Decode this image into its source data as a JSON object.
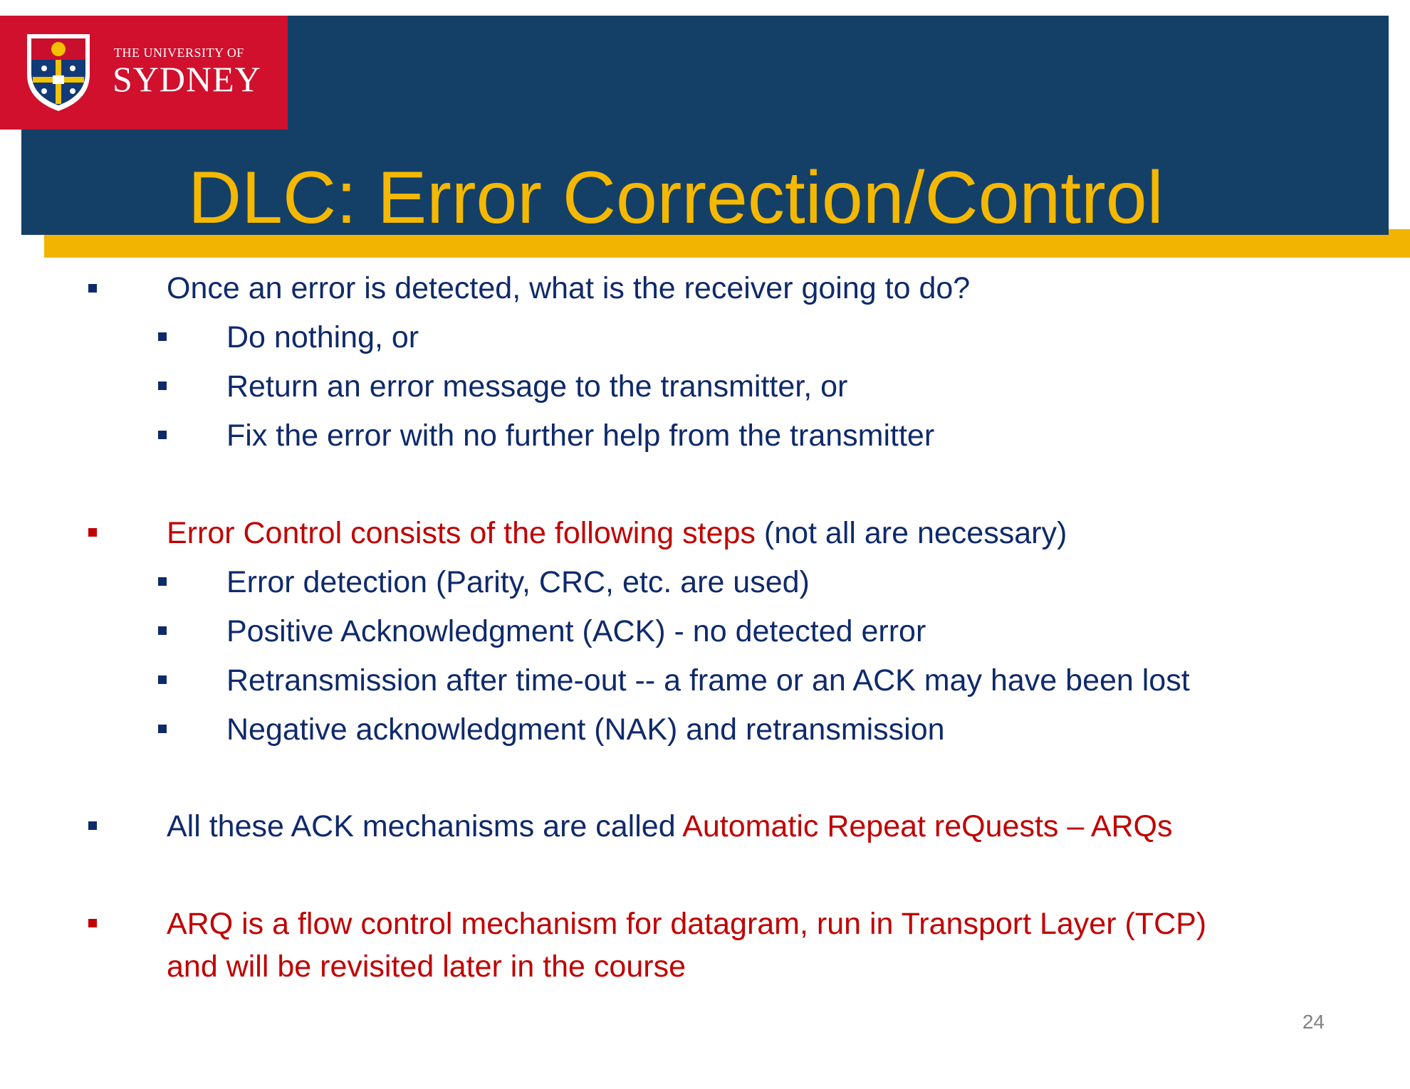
{
  "header": {
    "logo": {
      "line1": "THE UNIVERSITY OF",
      "line2": "SYDNEY",
      "crest_icon": "university-crest-icon"
    },
    "title": "DLC: Error Correction/Control"
  },
  "body": {
    "bullets": [
      {
        "text": "Once an error is detected, what is the receiver going to do?",
        "sub": [
          "Do nothing, or",
          "Return an error message to the transmitter, or",
          "Fix the error with no further help from the transmitter"
        ]
      },
      {
        "text_red": "Error Control consists of the following steps",
        "text_navy": " (not all are necessary)",
        "sub": [
          "Error detection (Parity, CRC, etc. are used)",
          "Positive Acknowledgment (ACK) - no detected error",
          "Retransmission after time-out -- a frame or an ACK may have been lost",
          "Negative acknowledgment (NAK) and retransmission"
        ]
      },
      {
        "text_navy": "All these ACK mechanisms are called ",
        "text_red": "Automatic Repeat reQuests – ARQs"
      },
      {
        "line1": "ARQ is a flow control mechanism for datagram, run in Transport Layer (TCP)",
        "line2": "and will be revisited later in the course"
      }
    ]
  },
  "page_number": "24",
  "colors": {
    "title_band": "#144068",
    "accent": "#f2b400",
    "logo_red": "#d0102d",
    "title_text": "#f5b800",
    "body_navy": "#0f2a6b",
    "body_red": "#c00000"
  }
}
